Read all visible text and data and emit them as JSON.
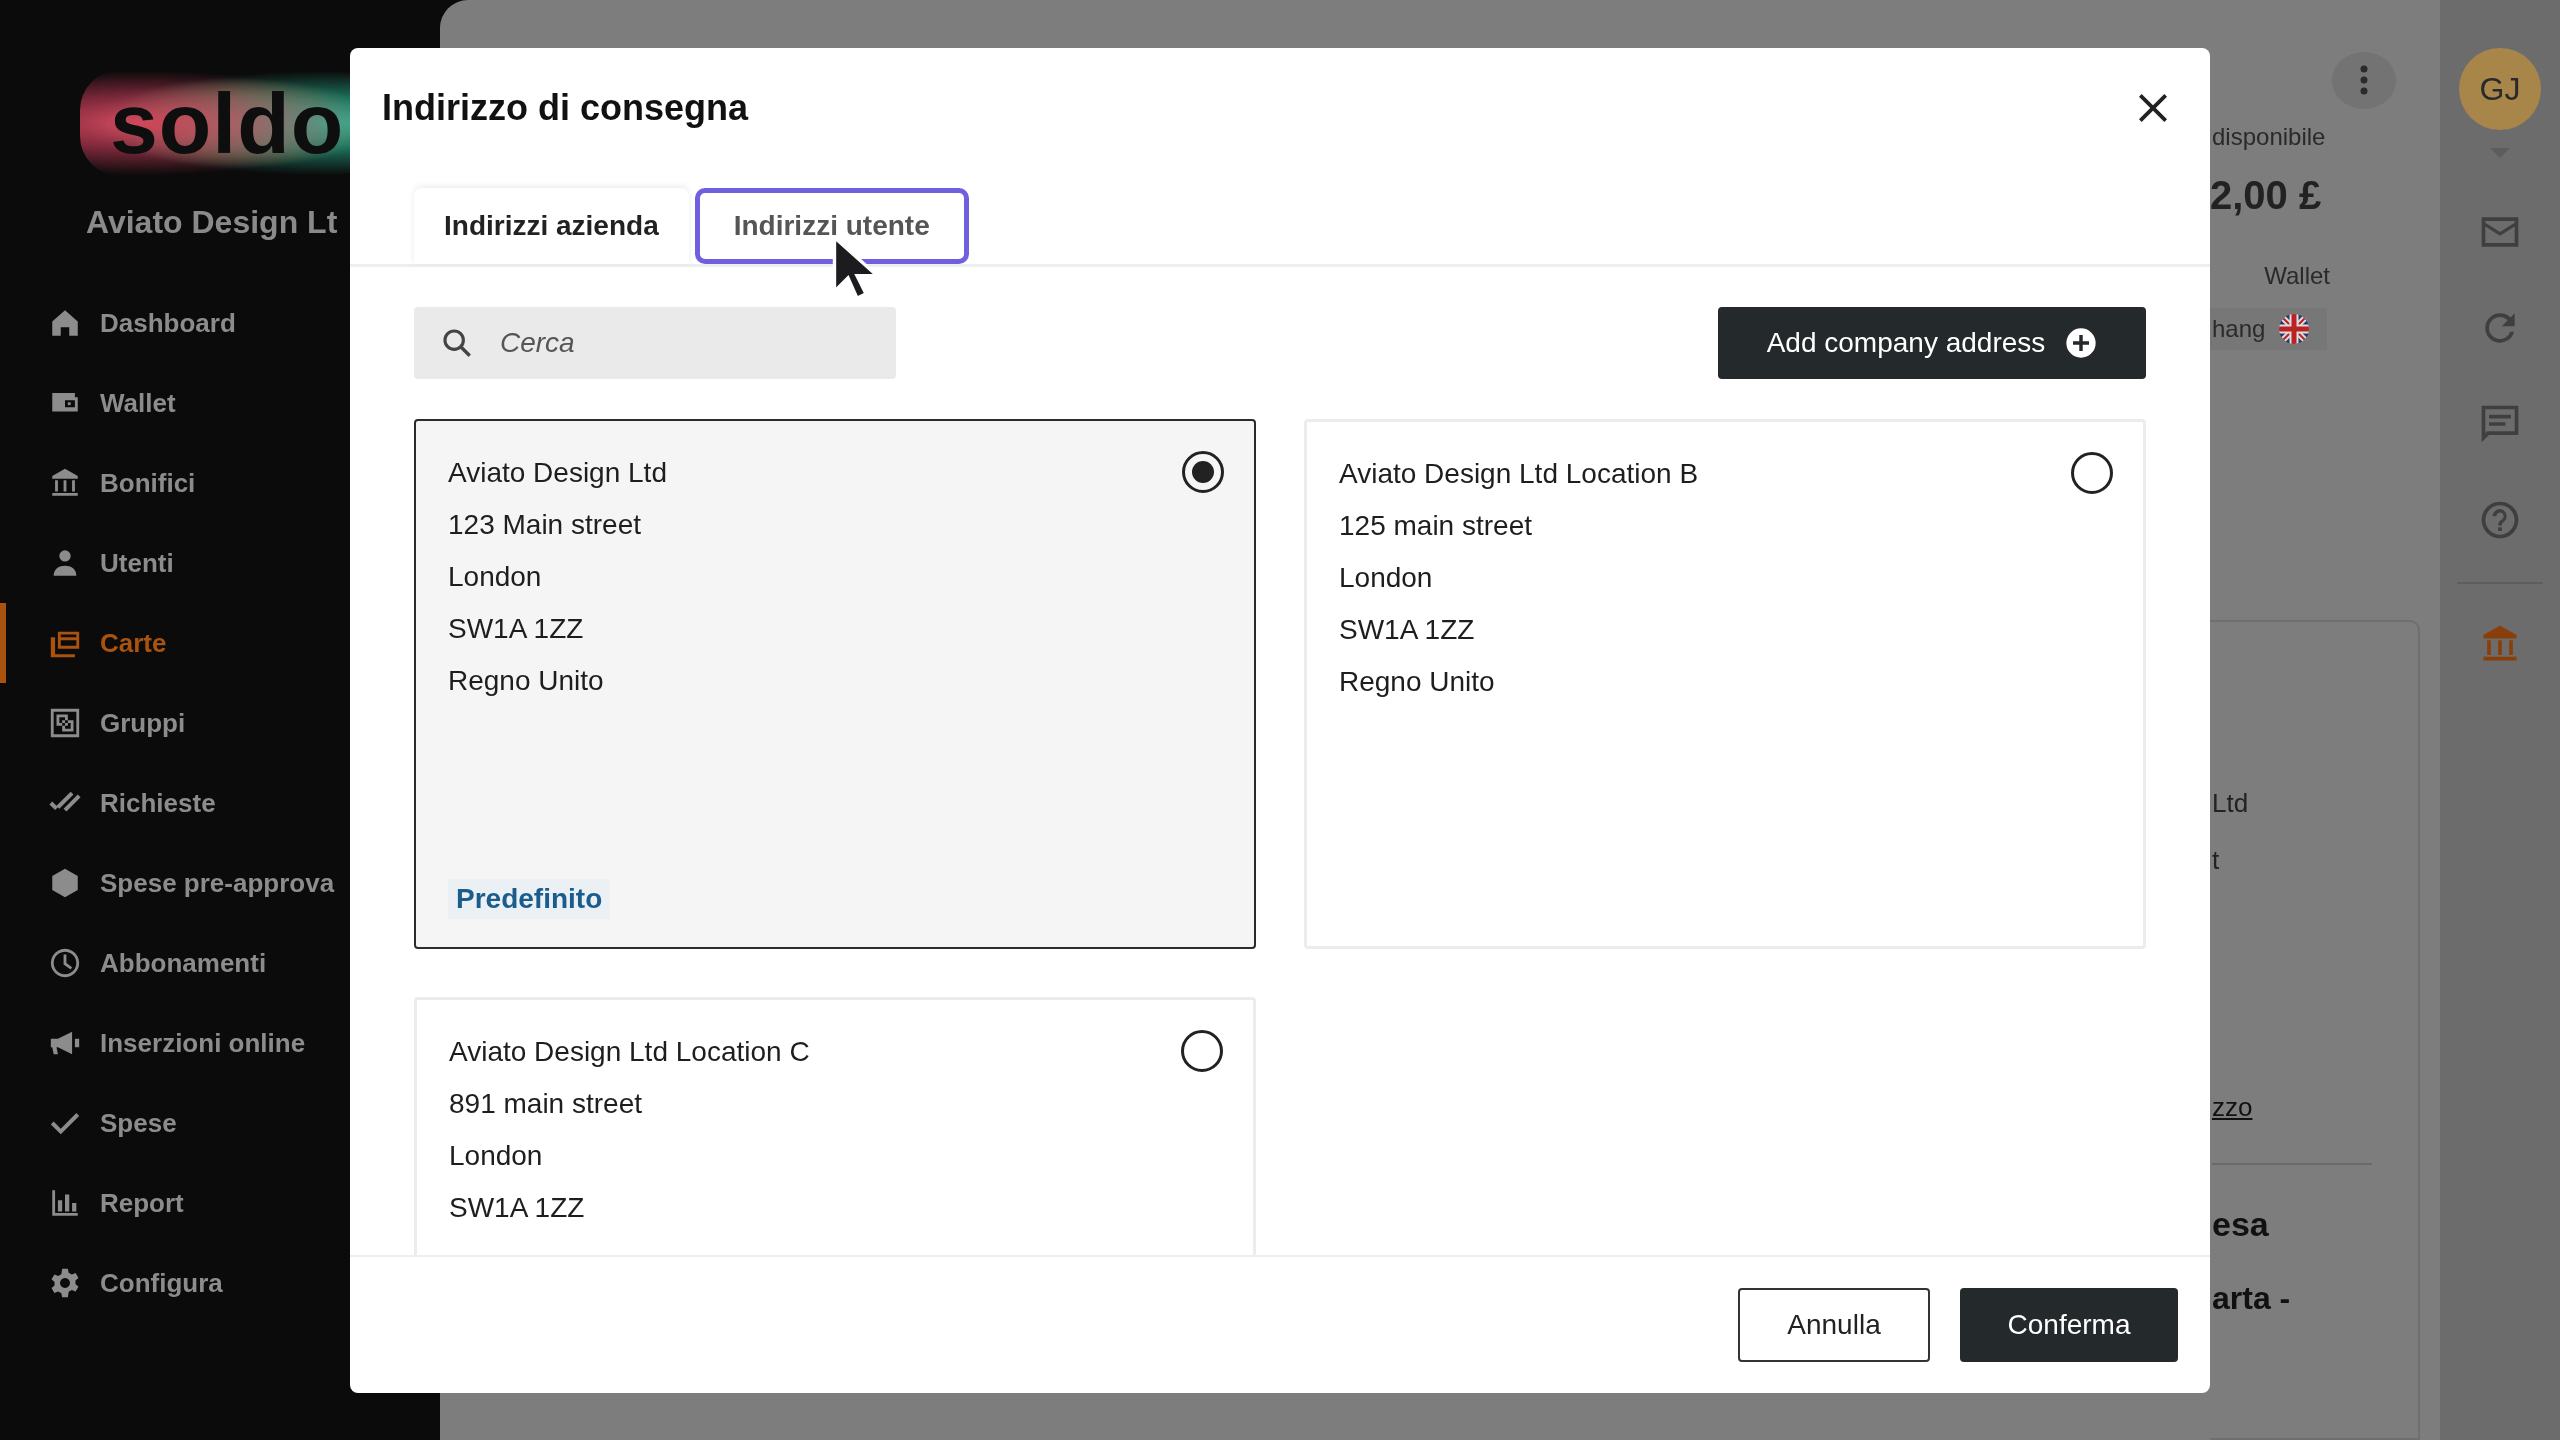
{
  "sidebar": {
    "logo": "soldo",
    "company": "Aviato Design Lt",
    "items": [
      {
        "label": "Dashboard",
        "selected": false
      },
      {
        "label": "Wallet",
        "selected": false
      },
      {
        "label": "Bonifici",
        "selected": false
      },
      {
        "label": "Utenti",
        "selected": false
      },
      {
        "label": "Carte",
        "selected": true
      },
      {
        "label": "Gruppi",
        "selected": false
      },
      {
        "label": "Richieste",
        "selected": false
      },
      {
        "label": "Spese pre-approva",
        "selected": false
      },
      {
        "label": "Abbonamenti",
        "selected": false
      },
      {
        "label": "Inserzioni online",
        "selected": false
      },
      {
        "label": "Spese",
        "selected": false
      },
      {
        "label": "Report",
        "selected": false
      },
      {
        "label": "Configura",
        "selected": false
      }
    ]
  },
  "background": {
    "balance_label": "disponibile",
    "balance": "2,00 £",
    "wallet_label": "Wallet",
    "wallet_chip": "hang",
    "card_lines": [
      "Ltd",
      "t"
    ],
    "link": "zzo",
    "heading": "esa",
    "subtext": "arta -"
  },
  "rail": {
    "avatar": "GJ"
  },
  "dialog": {
    "title": "Indirizzo di consegna",
    "tabs": [
      {
        "label": "Indirizzi azienda",
        "selected": true,
        "focused": false
      },
      {
        "label": "Indirizzi utente",
        "selected": false,
        "focused": true
      }
    ],
    "search": {
      "placeholder": "Cerca"
    },
    "add_button": "Add company address",
    "addresses": [
      {
        "lines": [
          "Aviato Design Ltd",
          "123 Main street",
          "London",
          "SW1A 1ZZ",
          "Regno Unito"
        ],
        "selected": true,
        "badge": "Predefinito"
      },
      {
        "lines": [
          "Aviato Design Ltd Location B",
          "125 main street",
          "London",
          "SW1A 1ZZ",
          "Regno Unito"
        ],
        "selected": false
      },
      {
        "lines": [
          "Aviato Design Ltd Location C",
          "891 main street",
          "London",
          "SW1A 1ZZ"
        ],
        "selected": false
      }
    ],
    "buttons": {
      "cancel": "Annulla",
      "confirm": "Conferma"
    }
  }
}
